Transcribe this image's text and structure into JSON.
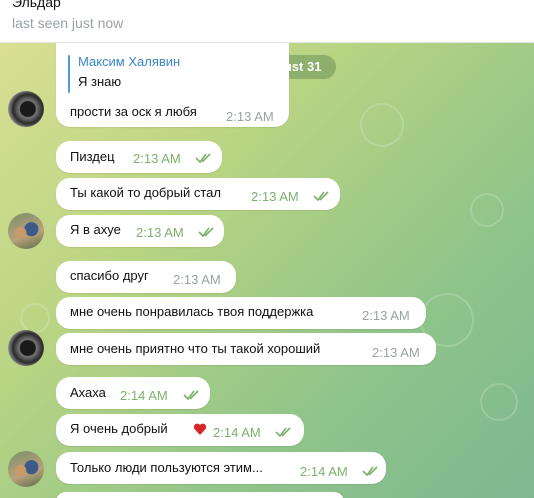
{
  "header": {
    "title": "Эльдар",
    "status": "last seen just now"
  },
  "chat": {
    "date": "August 31",
    "messages": [
      {
        "reply_to": {
          "name": "Максим Халявин",
          "text": "Я знаю"
        },
        "text": "прости за оск я любя",
        "time": "2:13 AM",
        "read": false
      },
      {
        "text": "Пиздец",
        "time": "2:13 AM",
        "read": true
      },
      {
        "text": "Ты какой то добрый стал",
        "time": "2:13 AM",
        "read": true
      },
      {
        "text": "Я в ахуе",
        "time": "2:13 AM",
        "read": true
      },
      {
        "text": "спасибо друг",
        "time": "2:13 AM",
        "read": false
      },
      {
        "text": "мне очень понравилась твоя поддержка",
        "time": "2:13 AM",
        "read": false
      },
      {
        "text": "мне очень приятно что ты такой хороший",
        "time": "2:13 AM",
        "read": false
      },
      {
        "text": "Ахаха",
        "time": "2:14 AM",
        "read": true
      },
      {
        "text": "Я очень добрый",
        "emoji": "heart-icon",
        "time": "2:14 AM",
        "read": true
      },
      {
        "text": "Только люди пользуются этим...",
        "time": "2:14 AM",
        "read": true
      }
    ]
  },
  "colors": {
    "accent": "#3a86c7",
    "read_time": "#7cb26b",
    "unread_time": "#9aa3a0",
    "bubble": "#ffffff"
  }
}
